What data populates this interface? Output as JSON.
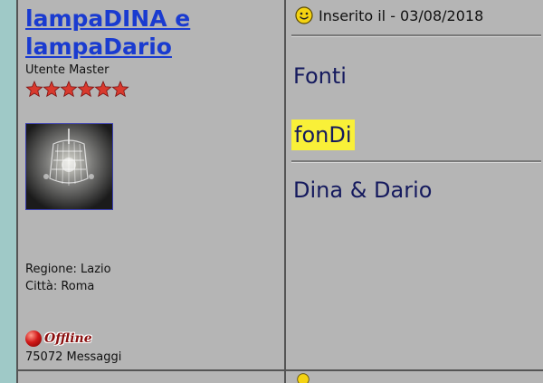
{
  "post": {
    "author": {
      "name": "lampaDINA e lampaDario",
      "rank": "Utente Master",
      "stars": 6,
      "region_label": "Regione: Lazio",
      "city_label": "Città: Roma",
      "status": "Offline",
      "post_count_label": "75072 Messaggi"
    },
    "posted_label": "Inserito il - 03/08/2018",
    "title": "Fonti",
    "highlighted_text": "fonDi",
    "signature": "Dina & Dario"
  },
  "icons": {
    "posted": "smiley-icon",
    "status": "offline-dot-icon",
    "rank": "star-icon"
  },
  "colors": {
    "username": "#1a3bd0",
    "cell_bg": "#b5b5b5",
    "page_bg": "#9fc9c7",
    "highlight": "#f9f038",
    "message_text": "#151a5e",
    "star": "#d93a2e",
    "offline": "#d21a1a"
  }
}
